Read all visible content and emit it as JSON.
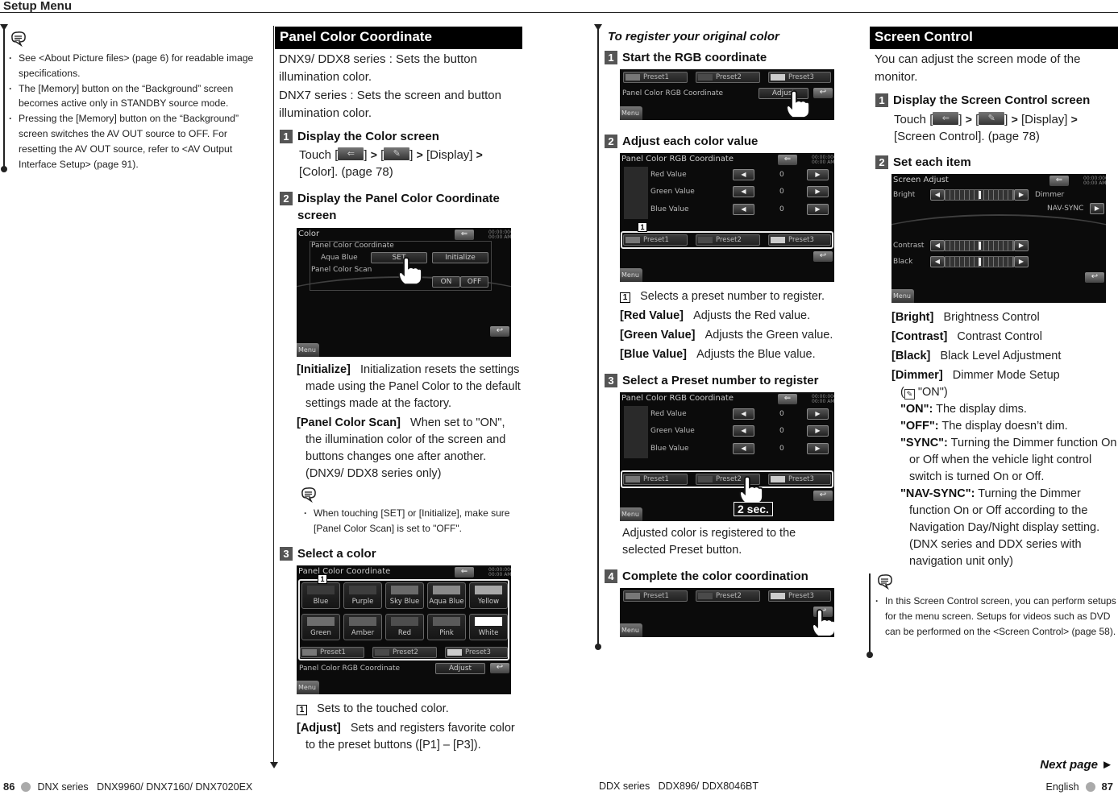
{
  "header": {
    "title": "Setup Menu"
  },
  "left_notes": {
    "items": [
      "See <About Picture files> (page 6) for readable image specifications.",
      "The [Memory] button on the “Background” screen becomes active only in STANDBY source mode.",
      "Pressing the [Memory] button on the “Background” screen switches the AV OUT source to OFF. For resetting the AV OUT source, refer to <AV Output Interface Setup> (page 91)."
    ]
  },
  "panel_color": {
    "title": "Panel Color Coordinate",
    "intro1": "DNX9/ DDX8 series : Sets the button illumination color.",
    "intro2": "DNX7 series : Sets the screen and button illumination color.",
    "step1": {
      "num": "1",
      "label": "Display the Color screen",
      "touch_prefix": "Touch [",
      "touch_mid1": "] ",
      "touch_mid2": " [",
      "touch_suffix": "] ",
      "after": " [Display] ",
      "end": "[Color]. (page 78)"
    },
    "step2": {
      "num": "2",
      "label": "Display the Panel Color Coordinate screen"
    },
    "screen_color": {
      "title": "Color",
      "section1": "Panel Color Coordinate",
      "current_color": "Aqua Blue",
      "set_button": "SET",
      "initialize_button": "Initialize",
      "section2": "Panel Color Scan",
      "on_button": "ON",
      "off_button": "OFF",
      "menu": "Menu",
      "clock": "00:00:0000\n00:00 AM"
    },
    "desc_initialize_key": "[Initialize]",
    "desc_initialize": "Initialization resets the settings made using the Panel Color to the default settings made at the factory.",
    "desc_scan_key": "[Panel Color Scan]",
    "desc_scan": "When set to \"ON\", the illumination color of the screen and buttons changes one after another. (DNX9/ DDX8 series only)",
    "note": "When touching [SET] or [Initialize], make sure [Panel Color Scan] is set to \"OFF\".",
    "step3": {
      "num": "3",
      "label": "Select a color"
    },
    "screen_select": {
      "title": "Panel Color Coordinate",
      "colors": [
        {
          "name": "Blue",
          "swatch": "#3a3a3a"
        },
        {
          "name": "Purple",
          "swatch": "#3e3e3e"
        },
        {
          "name": "Sky Blue",
          "swatch": "#6a6a6a"
        },
        {
          "name": "Aqua Blue",
          "swatch": "#8a8a8a"
        },
        {
          "name": "Yellow",
          "swatch": "#a8a8a8"
        },
        {
          "name": "Green",
          "swatch": "#6e6e6e"
        },
        {
          "name": "Amber",
          "swatch": "#5e5e5e"
        },
        {
          "name": "Red",
          "swatch": "#4e4e4e"
        },
        {
          "name": "Pink",
          "swatch": "#5a5a5a"
        },
        {
          "name": "White",
          "swatch": "#ffffff"
        }
      ],
      "presets": [
        {
          "name": "Preset1",
          "swatch": "#777777"
        },
        {
          "name": "Preset2",
          "swatch": "#4a4a4a"
        },
        {
          "name": "Preset3",
          "swatch": "#cccccc"
        }
      ],
      "rgb_label": "Panel Color RGB Coordinate",
      "adjust_button": "Adjust",
      "menu": "Menu",
      "callout": "1"
    },
    "callout1_num": "1",
    "callout1_text": "Sets to the touched color.",
    "desc_adjust_key": "[Adjust]",
    "desc_adjust": "Sets and registers favorite color to the preset buttons ([P1] – [P3])."
  },
  "register": {
    "heading": "To register your original color",
    "step1": {
      "num": "1",
      "label": "Start the RGB coordinate"
    },
    "step2": {
      "num": "2",
      "label": "Adjust each color value"
    },
    "screen_rgb": {
      "title": "Panel Color RGB Coordinate",
      "rows": [
        {
          "label": "Red Value",
          "value": "0"
        },
        {
          "label": "Green Value",
          "value": "0"
        },
        {
          "label": "Blue Value",
          "value": "0"
        }
      ],
      "left_arrow": "◀",
      "right_arrow": "▶",
      "menu": "Menu"
    },
    "callout1_num": "1",
    "callout1_text": "Selects a preset number to register.",
    "desc_red_key": "[Red Value]",
    "desc_red": "Adjusts the Red value.",
    "desc_green_key": "[Green Value]",
    "desc_green": "Adjusts the Green value.",
    "desc_blue_key": "[Blue Value]",
    "desc_blue": "Adjusts the Blue value.",
    "step3": {
      "num": "3",
      "label": "Select a Preset number to register"
    },
    "hold_badge": "2 sec.",
    "step3_result": "Adjusted color is registered to the selected Preset button.",
    "step4": {
      "num": "4",
      "label": "Complete the color coordination"
    }
  },
  "screen_control": {
    "title": "Screen Control",
    "intro": "You can adjust the screen mode of the monitor.",
    "step1": {
      "num": "1",
      "label": "Display the Screen Control screen",
      "touch_prefix": "Touch [",
      "touch_suffix": "] ",
      "after": " [Display] ",
      "end": "[Screen Control]. (page 78)"
    },
    "step2": {
      "num": "2",
      "label": "Set each item"
    },
    "screen_adjust": {
      "title": "Screen Adjust",
      "bright": "Bright",
      "contrast": "Contrast",
      "black": "Black",
      "dimmer": "Dimmer",
      "dimmer_value": "NAV-SYNC",
      "menu": "Menu",
      "bright_level": 0.5,
      "contrast_level": 0.5,
      "black_level": 0.5
    },
    "desc": [
      {
        "key": "[Bright]",
        "text": "Brightness Control"
      },
      {
        "key": "[Contrast]",
        "text": "Contrast Control"
      },
      {
        "key": "[Black]",
        "text": "Black Level Adjustment"
      },
      {
        "key": "[Dimmer]",
        "text": "Dimmer Mode Setup"
      }
    ],
    "dimmer_default": "\"ON\")",
    "dimmer_options": [
      {
        "key": "\"ON\":",
        "text": "The display dims."
      },
      {
        "key": "\"OFF\":",
        "text": "The display doesn’t dim."
      },
      {
        "key": "\"SYNC\":",
        "text": "Turning the Dimmer function On or Off when the vehicle light control switch is turned On or Off."
      },
      {
        "key": "\"NAV-SYNC\":",
        "text": "Turning the Dimmer function On or Off according to the Navigation Day/Night display setting. (DNX series and DDX series with navigation unit only)"
      }
    ],
    "note": "In this Screen Control screen, you can perform setups for the menu screen. Setups for videos such as DVD can be performed on the <Screen Control> (page 58)."
  },
  "footer": {
    "left_page": "86",
    "left_text": "DNX series   DNX9960/ DNX7160/ DNX7020EX",
    "center_text": "DDX series   DDX896/ DDX8046BT",
    "right_lang": "English",
    "right_page": "87",
    "next_page": "Next page ►"
  }
}
